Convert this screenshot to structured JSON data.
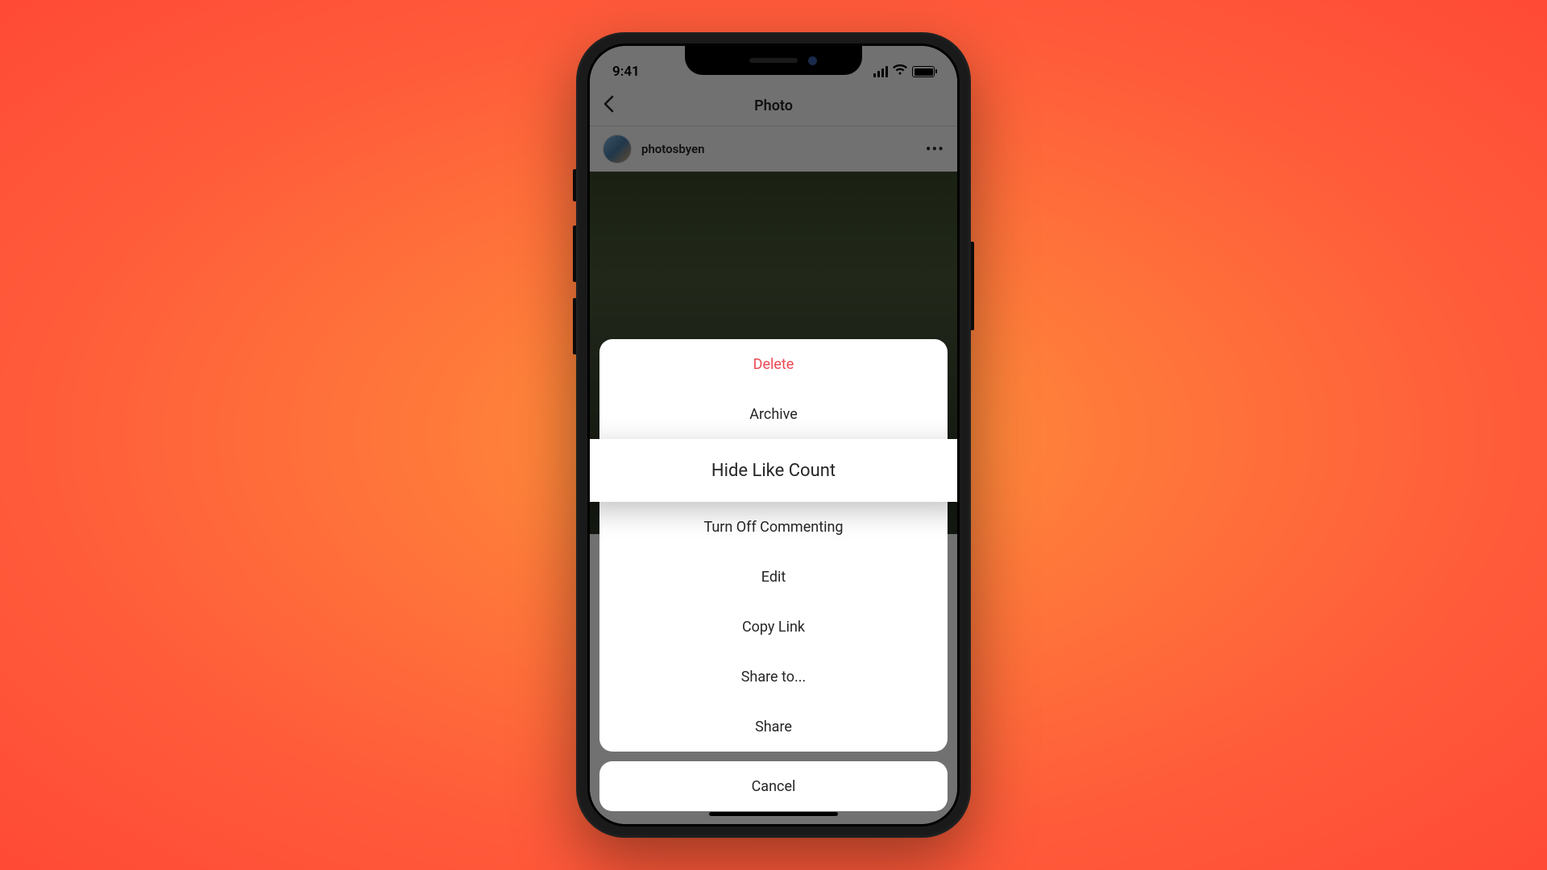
{
  "status": {
    "time": "9:41"
  },
  "nav": {
    "title": "Photo"
  },
  "post": {
    "username": "photosbyen"
  },
  "menu": {
    "delete": "Delete",
    "archive": "Archive",
    "hide_like": "Hide Like Count",
    "turn_off_commenting": "Turn Off Commenting",
    "edit": "Edit",
    "copy_link": "Copy Link",
    "share_to": "Share to...",
    "share": "Share",
    "cancel": "Cancel"
  }
}
